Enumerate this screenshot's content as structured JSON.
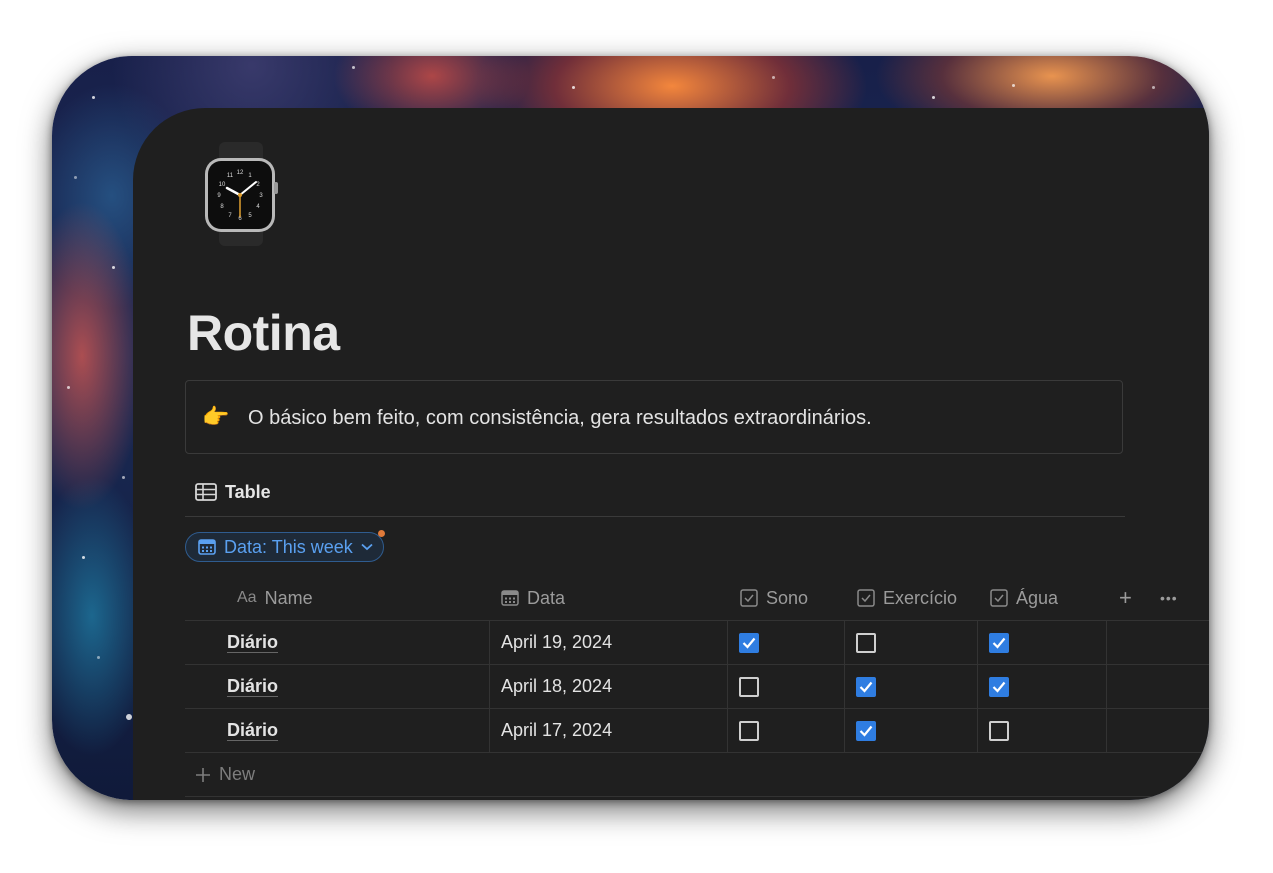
{
  "page": {
    "icon": "wristwatch-icon",
    "title": "Rotina"
  },
  "callout": {
    "icon": "backhand-index-pointing-right-emoji",
    "text": "O básico bem feito, com consistência, gera resultados extraordinários."
  },
  "view": {
    "icon": "table-icon",
    "label": "Table"
  },
  "filter": {
    "icon": "calendar-icon",
    "label": "Data: This week",
    "active_dot_color": "#e07a3a"
  },
  "table": {
    "columns": [
      {
        "label": "Name",
        "icon_text": "Aa"
      },
      {
        "label": "Data",
        "icon": "calendar-icon"
      },
      {
        "label": "Sono",
        "icon": "checkbox-icon"
      },
      {
        "label": "Exercício",
        "icon": "checkbox-icon"
      },
      {
        "label": "Água",
        "icon": "checkbox-icon"
      }
    ],
    "add_column_label": "+",
    "more_label": "•••",
    "rows": [
      {
        "name": "Diário",
        "date": "April 19, 2024",
        "sono": true,
        "exercicio": false,
        "agua": true
      },
      {
        "name": "Diário",
        "date": "April 18, 2024",
        "sono": false,
        "exercicio": true,
        "agua": true
      },
      {
        "name": "Diário",
        "date": "April 17, 2024",
        "sono": false,
        "exercicio": true,
        "agua": false
      }
    ],
    "new_row_label": "New"
  },
  "colors": {
    "page_bg": "#1f1f1f",
    "checkbox_checked": "#2f7de1",
    "filter_text": "#5aa0f0"
  }
}
